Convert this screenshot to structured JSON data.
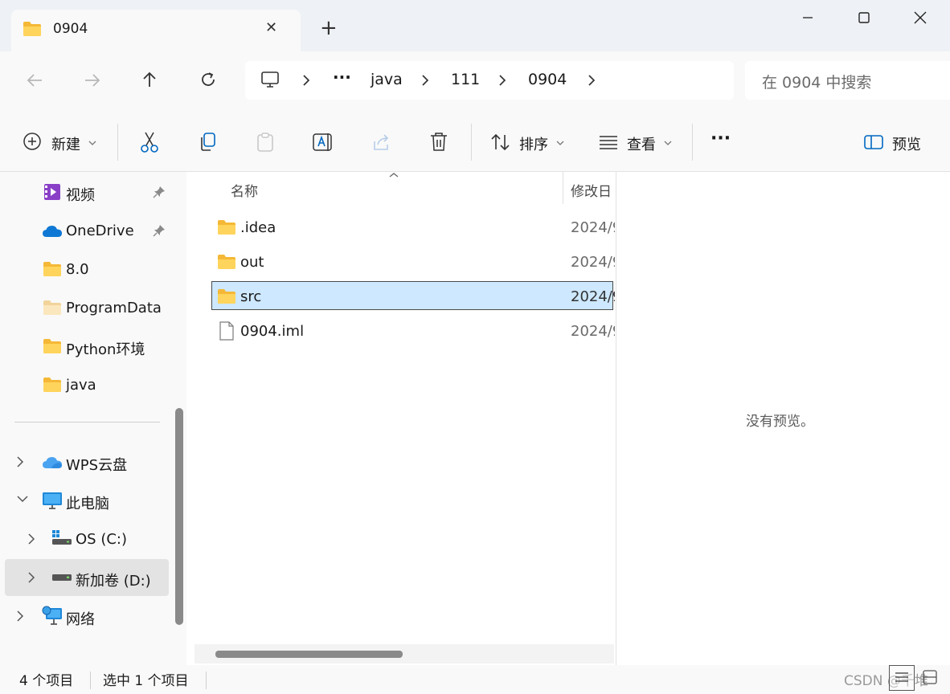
{
  "tab": {
    "title": "0904",
    "close_glyph": "✕",
    "new_tab_glyph": "+"
  },
  "window": {
    "minimize": "—",
    "maximize": "☐",
    "close": "✕"
  },
  "address": {
    "ellipsis": "···",
    "crumbs": [
      "java",
      "111",
      "0904"
    ],
    "search_placeholder": "在 0904 中搜索"
  },
  "toolbar": {
    "new_label": "新建",
    "sort_label": "排序",
    "view_label": "查看",
    "more_glyph": "···",
    "preview_label": "预览"
  },
  "sidebar": {
    "items": [
      {
        "label": "视频"
      },
      {
        "label": "OneDrive"
      },
      {
        "label": "8.0"
      },
      {
        "label": "ProgramData"
      },
      {
        "label": "Python环境"
      },
      {
        "label": "java"
      },
      {
        "label": "WPS云盘"
      },
      {
        "label": "此电脑"
      },
      {
        "label": "OS (C:)"
      },
      {
        "label": "新加卷 (D:)"
      },
      {
        "label": "网络"
      }
    ]
  },
  "columns": {
    "name": "名称",
    "date": "修改日"
  },
  "files": [
    {
      "name": ".idea",
      "date": "2024/9",
      "type": "folder"
    },
    {
      "name": "out",
      "date": "2024/9",
      "type": "folder"
    },
    {
      "name": "src",
      "date": "2024/9",
      "type": "folder",
      "selected": true
    },
    {
      "name": "0904.iml",
      "date": "2024/9",
      "type": "file"
    }
  ],
  "preview": {
    "empty_text": "没有预览。"
  },
  "status": {
    "count": "4 个项目",
    "selected": "选中 1 个项目",
    "watermark": "CSDN @千堆"
  },
  "colors": {
    "accent": "#0067c0",
    "selection": "#cde8ff",
    "folder": "#ffc83d"
  }
}
